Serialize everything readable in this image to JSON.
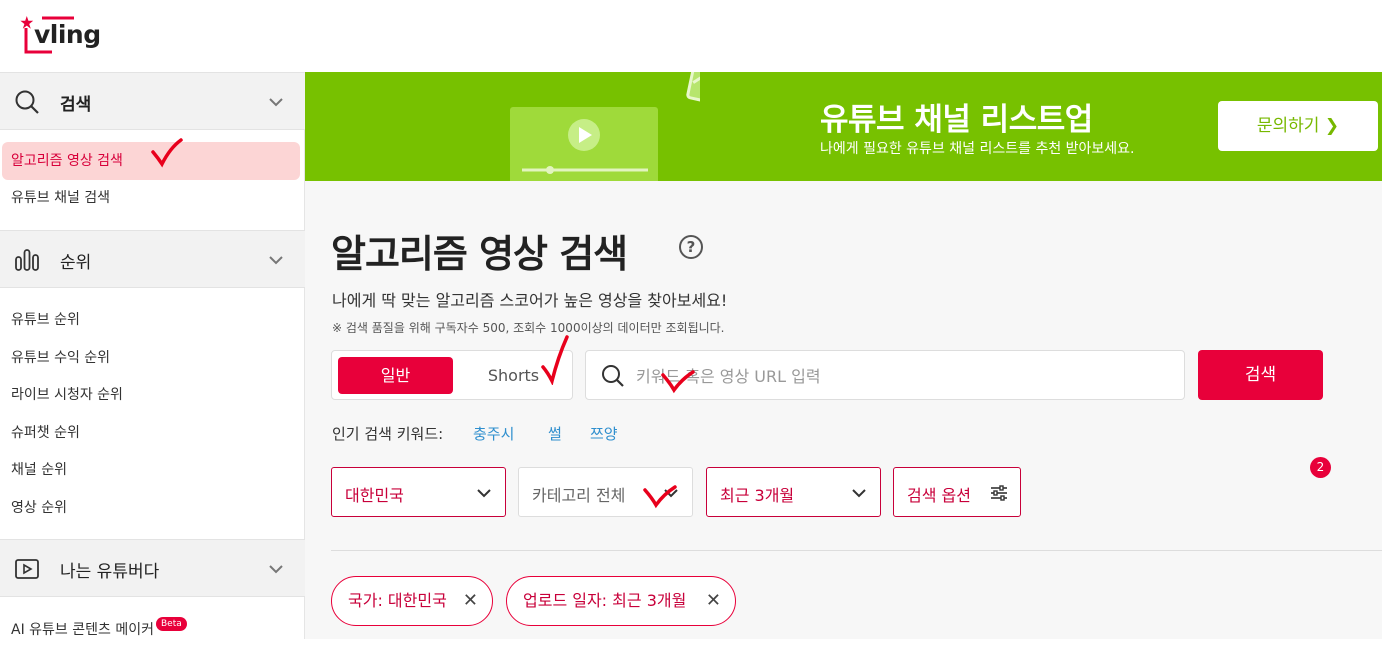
{
  "header": {
    "logo_text": "vling"
  },
  "sidebar": {
    "sections": [
      {
        "label": "검색",
        "icon": "search-icon"
      },
      {
        "label": "순위",
        "icon": "bar-chart-icon"
      },
      {
        "label": "나는 유튜버다",
        "icon": "play-box-icon"
      }
    ],
    "search_items": [
      "알고리즘 영상 검색",
      "유튜브 채널 검색"
    ],
    "rank_items": [
      "유튜브 순위",
      "유튜브 수익 순위",
      "라이브 시청자 순위",
      "슈퍼챗 순위",
      "채널 순위",
      "영상 순위"
    ],
    "creator_items": [
      {
        "label": "AI 유튜브 콘텐츠 메이커",
        "badge": "Beta"
      }
    ]
  },
  "banner": {
    "title": "유튜브 채널 리스트업",
    "subtitle": "나에게 필요한 유튜브 채널 리스트를 추천 받아보세요.",
    "button": "문의하기 ❯",
    "color": "#77c100"
  },
  "main": {
    "title": "알고리즘 영상 검색",
    "help": "?",
    "subtitle": "나에게 딱 맞는 알고리즘 스코어가 높은 영상을 찾아보세요!",
    "notice": "※ 검색 품질을 위해 구독자수 500, 조회수 1000이상의 데이터만 조회됩니다.",
    "toggle": {
      "active": "일반",
      "inactive": "Shorts"
    },
    "search": {
      "placeholder": "키워드 혹은 영상 URL 입력",
      "value": "",
      "button": "검색"
    },
    "popular_label": "인기 검색 키워드:",
    "popular_keywords": [
      "충주시",
      "썰",
      "쯔양"
    ],
    "filters": {
      "country": "대한민국",
      "category": "카테고리 전체",
      "period": "최근 3개월",
      "options": "검색 옵션",
      "options_badge": "2"
    },
    "chips": [
      "국가: 대한민국",
      "업로드 일자: 최근 3개월"
    ],
    "accent": "#e8003a"
  }
}
